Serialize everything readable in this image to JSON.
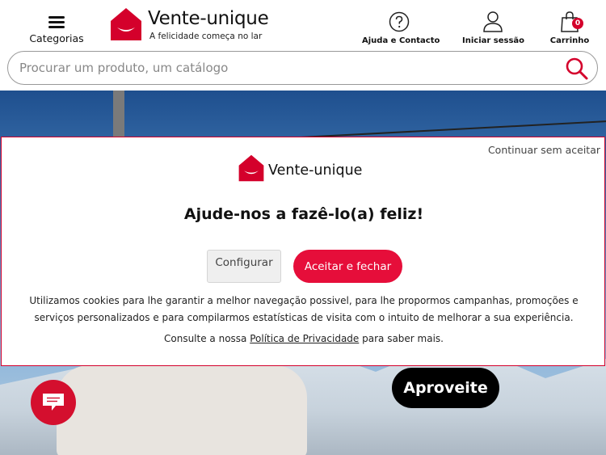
{
  "header": {
    "categories_label": "Categorias",
    "logo_brand": "Vente-unique",
    "logo_tagline": "A felicidade começa no lar",
    "help_label": "Ajuda e Contacto",
    "login_label": "Iniciar sessão",
    "cart_label": "Carrinho",
    "cart_count": "0"
  },
  "search": {
    "placeholder": "Procurar um produto, um catálogo"
  },
  "hero": {
    "cta_label": "Aproveite"
  },
  "cookie_modal": {
    "continue_label": "Continuar sem aceitar",
    "logo_brand": "Vente-unique",
    "title": "Ajude-nos a fazê-lo(a) feliz!",
    "configure_label": "Configurar",
    "accept_label": "Aceitar e fechar",
    "body_text": "Utilizamos cookies para lhe garantir a melhor navegação possivel, para lhe propormos campanhas, promoções e serviços personalizados e para compilarmos estatísticas de visita com o intuito de melhorar a sua experiência.",
    "consult_prefix": "Consulte a nossa ",
    "privacy_link": "Política de Privacidade",
    "consult_suffix": " para saber mais."
  },
  "colors": {
    "brand_red": "#e60e3a",
    "badge_red": "#d4002b"
  },
  "icons": {
    "menu": "hamburger-icon",
    "help": "question-icon",
    "account": "user-icon",
    "cart": "bag-icon",
    "search": "search-icon",
    "chat": "chat-icon"
  }
}
